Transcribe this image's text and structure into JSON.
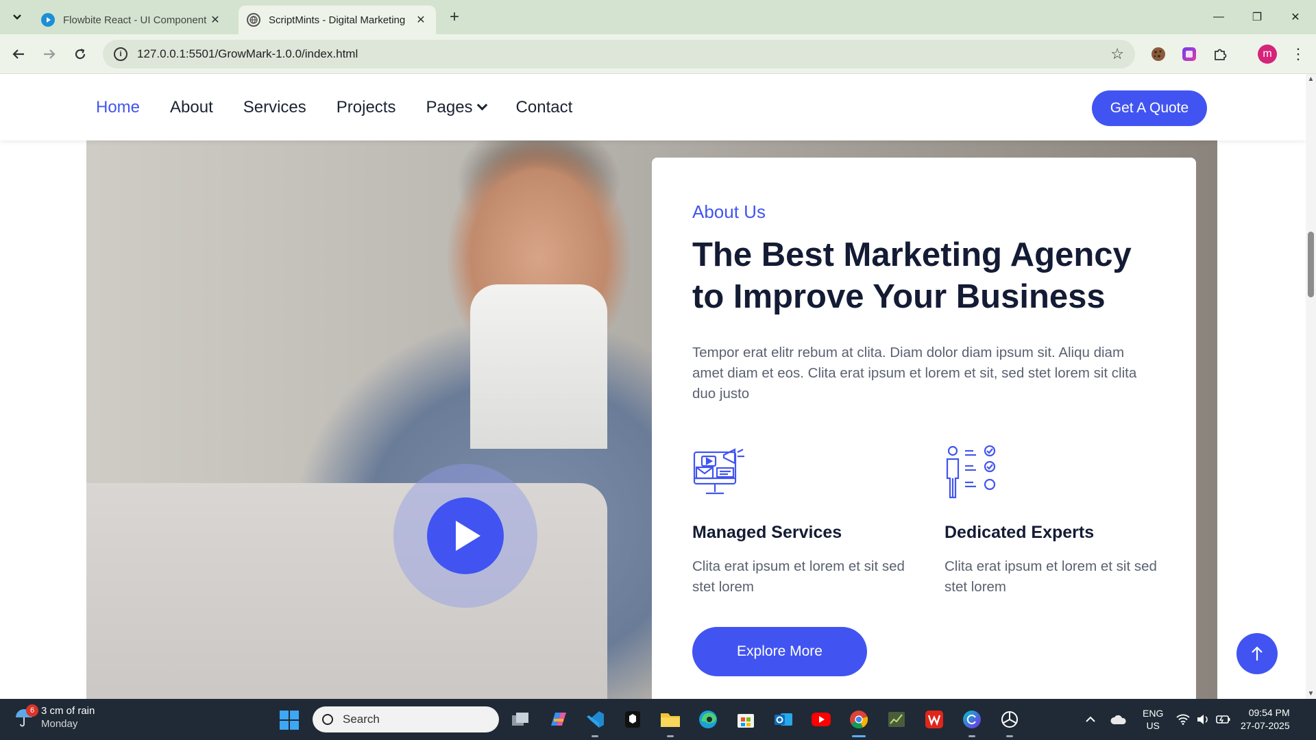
{
  "browser": {
    "tabs": [
      {
        "title": "Flowbite React - UI Component",
        "active": false
      },
      {
        "title": "ScriptMints - Digital Marketing",
        "active": true
      }
    ],
    "url": "127.0.0.1:5501/GrowMark-1.0.0/index.html",
    "profile_initial": "m"
  },
  "site": {
    "nav": {
      "items": [
        "Home",
        "About",
        "Services",
        "Projects",
        "Pages",
        "Contact"
      ],
      "active": "Home",
      "cta": "Get A Quote"
    },
    "about": {
      "eyebrow": "About Us",
      "heading": "The Best Marketing Agency to Improve Your Business",
      "paragraph": "Tempor erat elitr rebum at clita. Diam dolor diam ipsum sit. Aliqu diam amet diam et eos. Clita erat ipsum et lorem et sit, sed stet lorem sit clita duo justo",
      "features": [
        {
          "icon": "digital-marketing-icon",
          "title": "Managed Services",
          "text": "Clita erat ipsum et lorem et sit sed stet lorem"
        },
        {
          "icon": "experts-checklist-icon",
          "title": "Dedicated Experts",
          "text": "Clita erat ipsum et lorem et sit sed stet lorem"
        }
      ],
      "button": "Explore More"
    },
    "accent_color": "#4154f1"
  },
  "taskbar": {
    "weather": {
      "badge": "6",
      "line1": "3 cm of rain",
      "line2": "Monday"
    },
    "search_placeholder": "Search",
    "language": {
      "line1": "ENG",
      "line2": "US"
    },
    "clock": {
      "time": "09:54 PM",
      "date": "27-07-2025"
    }
  }
}
